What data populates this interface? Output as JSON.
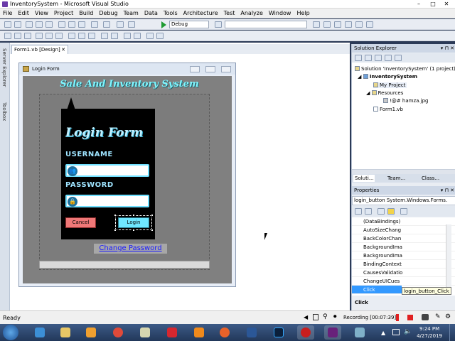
{
  "window": {
    "title": "InventorySystem - Microsoft Visual Studio",
    "controls": [
      "–",
      "□",
      "✕"
    ]
  },
  "menu": [
    "File",
    "Edit",
    "View",
    "Project",
    "Build",
    "Debug",
    "Team",
    "Data",
    "Tools",
    "Architecture",
    "Test",
    "Analyze",
    "Window",
    "Help"
  ],
  "toolbar": {
    "config_value": "Debug"
  },
  "left_tabs": {
    "server_explorer": "Server Explorer",
    "toolbox": "Toolbox"
  },
  "doc_tab": {
    "label": "Form1.vb [Design]",
    "close": "✕"
  },
  "form": {
    "title": "Login Form",
    "app_title": "Sale And Inventory System",
    "login_heading": "Login Form",
    "username_label": "USERNAME",
    "password_label": "PASSWORD",
    "cancel_label": "Cancel",
    "login_label": "Login",
    "change_password": "Change Password"
  },
  "solution_explorer": {
    "title": "Solution Explorer",
    "items": [
      {
        "label": "Solution 'InventorySystem' (1 project)"
      },
      {
        "label": "InventorySystem"
      },
      {
        "label": "My Project"
      },
      {
        "label": "Resources"
      },
      {
        "label": "!@# hamza.jpg"
      },
      {
        "label": "Form1.vb"
      }
    ],
    "tabs": [
      "Soluti...",
      "Team...",
      "Class..."
    ]
  },
  "properties": {
    "title": "Properties",
    "object": "login_button  System.Windows.Forms.",
    "rows": [
      "(DataBindings)",
      "AutoSizeChang",
      "BackColorChan",
      "BackgroundIma",
      "BackgroundIma",
      "BindingContext",
      "CausesValidatio",
      "ChangeUICues",
      "Click"
    ],
    "selected": "Click",
    "description": "Click",
    "tooltip": "login_button_Click"
  },
  "status": {
    "left": "Ready",
    "recording": "Recording [00:07:39]"
  },
  "clock": {
    "time": "9:24 PM",
    "date": "4/27/2019"
  },
  "colors": {
    "accent_cyan": "#6fe7ff",
    "cancel_red": "#f07878",
    "vs_blue": "#2b3a57"
  }
}
